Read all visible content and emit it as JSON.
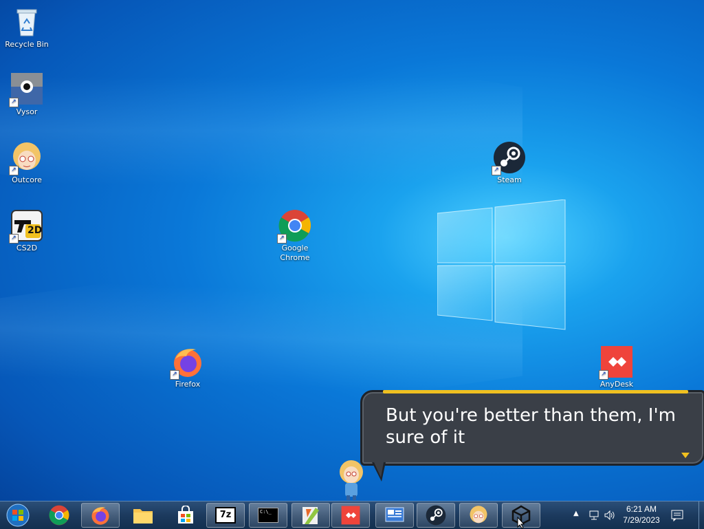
{
  "desktop": {
    "icons": [
      {
        "label": "Recycle Bin",
        "icon": "recycle-bin-icon"
      },
      {
        "label": "Vysor",
        "icon": "vysor-icon"
      },
      {
        "label": "Outcore",
        "icon": "outcore-icon"
      },
      {
        "label": "CS2D",
        "icon": "cs2d-icon"
      },
      {
        "label": "Google Chrome",
        "icon": "chrome-icon"
      },
      {
        "label": "Steam",
        "icon": "steam-icon"
      },
      {
        "label": "Firefox",
        "icon": "firefox-icon"
      },
      {
        "label": "AnyDesk",
        "icon": "anydesk-icon"
      }
    ],
    "cs2d_badge": "2D"
  },
  "dialog": {
    "text": "But you're better than them, I'm sure of it",
    "accent": "#f0c020"
  },
  "taskbar": {
    "buttons": [
      {
        "name": "Google Chrome",
        "icon": "chrome-icon"
      },
      {
        "name": "Firefox",
        "icon": "firefox-icon"
      },
      {
        "name": "File Explorer",
        "icon": "folder-icon"
      },
      {
        "name": "Microsoft Store",
        "icon": "store-icon"
      },
      {
        "name": "7-Zip",
        "icon": "7zip-icon",
        "text": "7z"
      },
      {
        "name": "Command Prompt",
        "icon": "cmd-icon",
        "text": "C:\\_"
      },
      {
        "name": "Notepad++",
        "icon": "notepadpp-icon"
      },
      {
        "name": "AnyDesk",
        "icon": "anydesk-icon"
      },
      {
        "name": "Control Panel",
        "icon": "control-panel-icon"
      },
      {
        "name": "Steam",
        "icon": "steam-icon"
      },
      {
        "name": "Outcore",
        "icon": "outcore-icon"
      },
      {
        "name": "Unity",
        "icon": "unity-icon"
      }
    ],
    "clock": {
      "time": "6:21 AM",
      "date": "7/29/2023"
    }
  }
}
